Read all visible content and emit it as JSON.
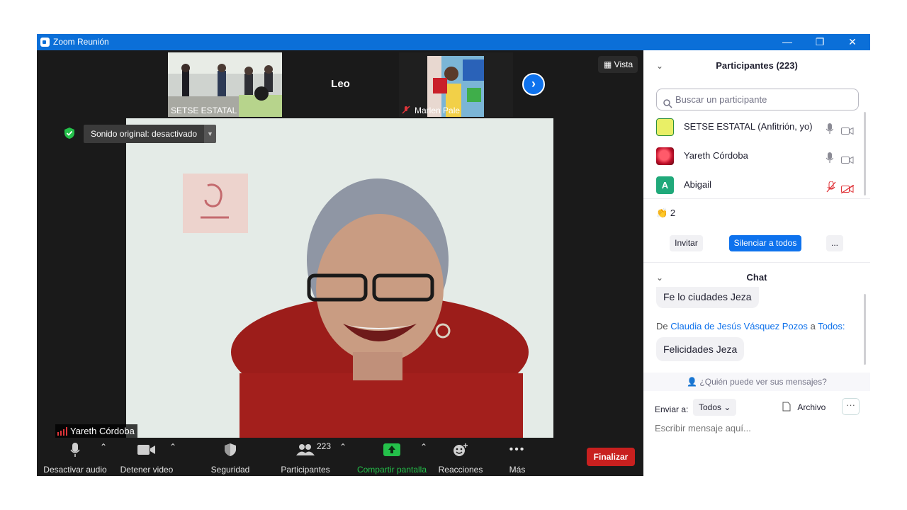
{
  "window": {
    "title": "Zoom Reunión",
    "controls": {
      "minimize": "—",
      "restore": "❐",
      "close": "✕"
    }
  },
  "stage": {
    "thumbnails": [
      {
        "name": "SETSE ESTATAL",
        "muted": true
      },
      {
        "name": "Leo",
        "muted": false
      },
      {
        "name": "Marlen Pale",
        "muted": true
      }
    ],
    "view_label": "Vista",
    "sound_label": "Sonido original: desactivado",
    "speaker_name": "Yareth Córdoba"
  },
  "toolbar": {
    "audio": "Desactivar audio",
    "video": "Detener video",
    "security": "Seguridad",
    "participants": "Participantes",
    "participants_count": "223",
    "share": "Compartir pantalla",
    "reactions": "Reacciones",
    "more": "Más",
    "end": "Finalizar"
  },
  "panel": {
    "participants_title": "Participantes (223)",
    "search_placeholder": "Buscar un participante",
    "participants": [
      {
        "name": "SETSE ESTATAL (Anfitrión, yo)",
        "avatar": "logo",
        "muted": false,
        "video_off": false
      },
      {
        "name": "Yareth Córdoba",
        "avatar": "photo",
        "muted": false,
        "video_off": false
      },
      {
        "name": "Abigail",
        "avatar": "A",
        "muted": true,
        "video_off": true
      }
    ],
    "reaction_count": "2",
    "invite": "Invitar",
    "mute_all": "Silenciar a todos",
    "more": "...",
    "chat_title": "Chat",
    "messages": [
      {
        "text": "Fe lo ciudades Jeza"
      },
      {
        "text": "Felicidades Jeza"
      }
    ],
    "from": {
      "prefix": "De",
      "sender": "Claudia de Jesús Vásquez Pozos",
      "middle": "a",
      "to": "Todos:"
    },
    "who_sees": "¿Quién puede ver sus mensajes?",
    "send_to_label": "Enviar a:",
    "send_to_value": "Todos",
    "file_label": "Archivo",
    "message_placeholder": "Escribir mensaje aquí..."
  },
  "colors": {
    "accent": "#0e72ed",
    "titlebar": "#0b6fd8",
    "end": "#c8201f",
    "share": "#24c04a"
  }
}
